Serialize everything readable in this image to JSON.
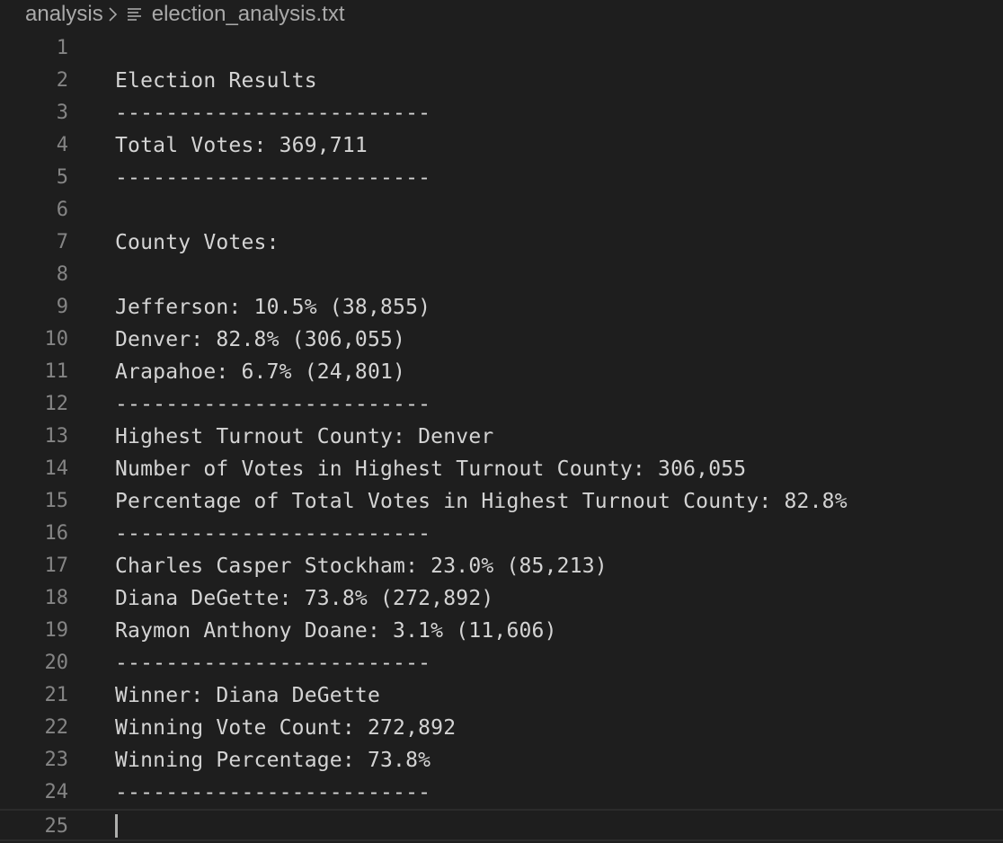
{
  "breadcrumb": {
    "folder": "analysis",
    "separator_icon": "chevron-right-icon",
    "file_icon": "text-lines-icon",
    "file": "election_analysis.txt"
  },
  "editor": {
    "lines": [
      {
        "number": "1",
        "text": ""
      },
      {
        "number": "2",
        "text": "Election Results"
      },
      {
        "number": "3",
        "text": "-------------------------"
      },
      {
        "number": "4",
        "text": "Total Votes: 369,711"
      },
      {
        "number": "5",
        "text": "-------------------------"
      },
      {
        "number": "6",
        "text": ""
      },
      {
        "number": "7",
        "text": "County Votes:"
      },
      {
        "number": "8",
        "text": ""
      },
      {
        "number": "9",
        "text": "Jefferson: 10.5% (38,855)"
      },
      {
        "number": "10",
        "text": "Denver: 82.8% (306,055)"
      },
      {
        "number": "11",
        "text": "Arapahoe: 6.7% (24,801)"
      },
      {
        "number": "12",
        "text": "-------------------------"
      },
      {
        "number": "13",
        "text": "Highest Turnout County: Denver"
      },
      {
        "number": "14",
        "text": "Number of Votes in Highest Turnout County: 306,055"
      },
      {
        "number": "15",
        "text": "Percentage of Total Votes in Highest Turnout County: 82.8%"
      },
      {
        "number": "16",
        "text": "-------------------------"
      },
      {
        "number": "17",
        "text": "Charles Casper Stockham: 23.0% (85,213)"
      },
      {
        "number": "18",
        "text": "Diana DeGette: 73.8% (272,892)"
      },
      {
        "number": "19",
        "text": "Raymon Anthony Doane: 3.1% (11,606)"
      },
      {
        "number": "20",
        "text": "-------------------------"
      },
      {
        "number": "21",
        "text": "Winner: Diana DeGette"
      },
      {
        "number": "22",
        "text": "Winning Vote Count: 272,892"
      },
      {
        "number": "23",
        "text": "Winning Percentage: 73.8%"
      },
      {
        "number": "24",
        "text": "-------------------------"
      },
      {
        "number": "25",
        "text": ""
      }
    ]
  }
}
